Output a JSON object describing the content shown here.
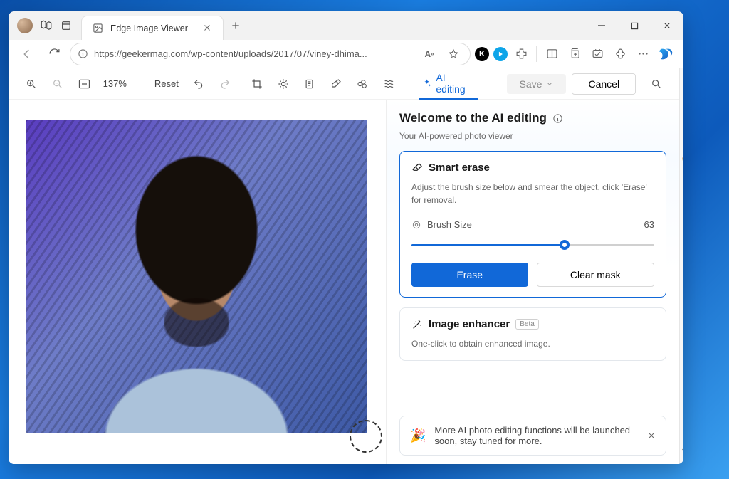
{
  "tab": {
    "title": "Edge Image Viewer"
  },
  "url": "https://geekermag.com/wp-content/uploads/2017/07/viney-dhima...",
  "toolbar": {
    "zoom": "137%",
    "reset": "Reset",
    "ai_editing": "AI editing",
    "save": "Save",
    "cancel": "Cancel"
  },
  "panel": {
    "heading": "Welcome to the AI editing",
    "subheading": "Your AI-powered photo viewer",
    "smart_erase": {
      "title": "Smart erase",
      "description": "Adjust the brush size below and smear the object, click 'Erase' for removal.",
      "brush_label": "Brush Size",
      "brush_value": "63",
      "erase": "Erase",
      "clear": "Clear mask"
    },
    "enhancer": {
      "title": "Image enhancer",
      "badge": "Beta",
      "description": "One-click to obtain enhanced image."
    },
    "toast": "More AI photo editing functions will be launched soon, stay tuned for more."
  },
  "sidebar_letters": [
    "K"
  ]
}
